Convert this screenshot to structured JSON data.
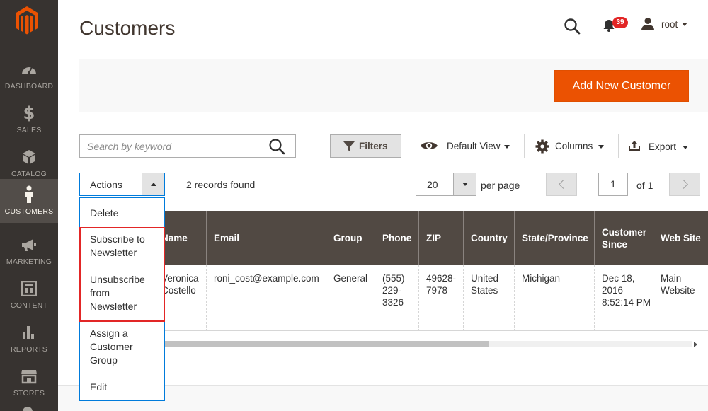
{
  "sidebar": {
    "items": [
      {
        "label": "Dashboard",
        "icon": "dashboard-icon"
      },
      {
        "label": "Sales",
        "icon": "dollar-icon"
      },
      {
        "label": "Catalog",
        "icon": "cube-icon"
      },
      {
        "label": "Customers",
        "icon": "person-icon",
        "active": true
      },
      {
        "label": "Marketing",
        "icon": "megaphone-icon"
      },
      {
        "label": "Content",
        "icon": "layout-icon"
      },
      {
        "label": "Reports",
        "icon": "bar-chart-icon"
      },
      {
        "label": "Stores",
        "icon": "storefront-icon"
      }
    ]
  },
  "header": {
    "title": "Customers",
    "notifications_count": "39",
    "user_name": "root"
  },
  "action_bar": {
    "add_button_label": "Add New Customer"
  },
  "toolbar": {
    "search_placeholder": "Search by keyword",
    "filters_label": "Filters",
    "view_label": "Default View",
    "columns_label": "Columns",
    "export_label": "Export"
  },
  "grid_controls": {
    "actions_label": "Actions",
    "records_found": "2 records found",
    "per_page_value": "20",
    "per_page_label": "per page",
    "current_page": "1",
    "page_total": "of 1"
  },
  "actions_menu": {
    "items": [
      "Delete",
      "Subscribe to Newsletter",
      "Unsubscribe from Newsletter",
      "Assign a Customer Group",
      "Edit"
    ]
  },
  "table": {
    "columns": [
      "Name",
      "Email",
      "Group",
      "Phone",
      "ZIP",
      "Country",
      "State/Province",
      "Customer Since",
      "Web Site"
    ],
    "rows": [
      {
        "name": "Veronica Costello",
        "email": "roni_cost@example.com",
        "group": "General",
        "phone": "(555) 229-3326",
        "zip": "49628-7978",
        "country": "United States",
        "state": "Michigan",
        "customer_since": "Dec 18, 2016 8:52:14 PM",
        "website": "Main Website"
      }
    ]
  },
  "colors": {
    "sidebar_bg": "#373330",
    "accent_orange": "#eb5202",
    "table_header_bg": "#514943",
    "badge_red": "#e22626",
    "highlight_red": "#e22626",
    "focus_blue": "#007bdb"
  }
}
